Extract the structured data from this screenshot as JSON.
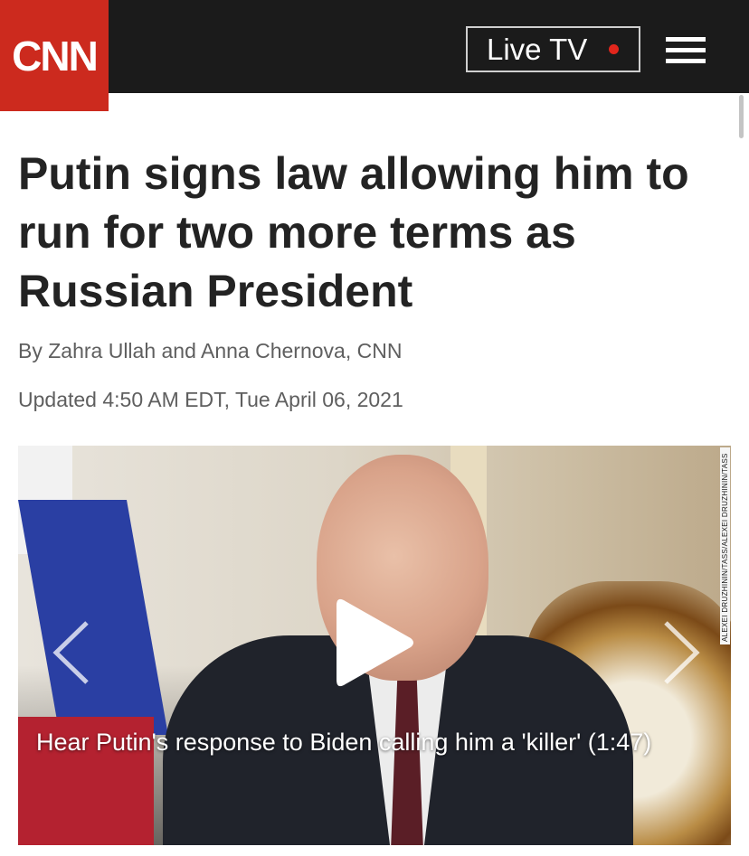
{
  "header": {
    "logo_text": "CNN",
    "live_tv_label": "Live TV",
    "live_indicator_color": "#e1261c",
    "brand_color": "#cc2a1e"
  },
  "article": {
    "headline": "Putin signs law allowing him to run for two more terms as Russian President",
    "byline": "By Zahra Ullah and Anna Chernova, CNN",
    "updated": "Updated 4:50 AM EDT, Tue April 06, 2021"
  },
  "video": {
    "caption": "Hear Putin's response to Biden calling him a 'killer' (1:47)",
    "photo_credit": "ALEXEI DRUZHININ/TASS/ALEXEI DRUZHININ/TASS"
  },
  "icons": {
    "menu": "hamburger-menu-icon",
    "play": "play-icon",
    "previous": "chevron-left-icon",
    "next": "chevron-right-icon"
  }
}
